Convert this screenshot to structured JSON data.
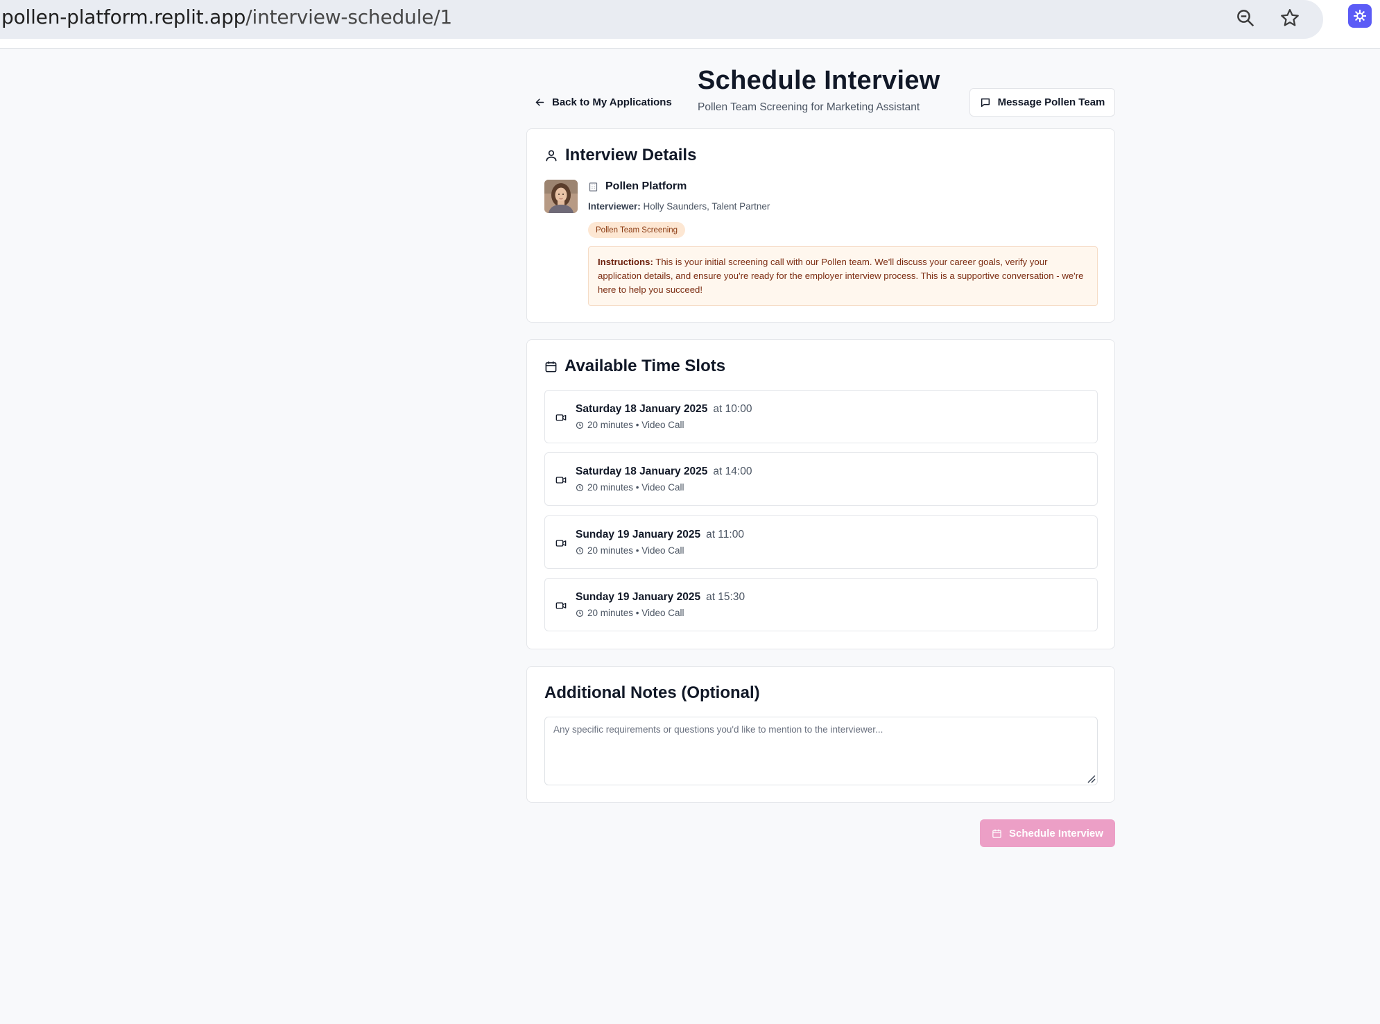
{
  "browser": {
    "url_host": "pollen-platform.replit.app",
    "url_path": "/interview-schedule/1"
  },
  "header": {
    "back_label": "Back to My Applications",
    "title": "Schedule Interview",
    "subtitle": "Pollen Team Screening for Marketing Assistant",
    "message_button": "Message Pollen Team"
  },
  "details": {
    "title": "Interview Details",
    "company": "Pollen Platform",
    "interviewer_label": "Interviewer:",
    "interviewer_value": "Holly Saunders, Talent Partner",
    "badge": "Pollen Team Screening",
    "instructions_label": "Instructions:",
    "instructions_text": "This is your initial screening call with our Pollen team. We'll discuss your career goals, verify your application details, and ensure you're ready for the employer interview process. This is a supportive conversation - we're here to help you succeed!"
  },
  "slots": {
    "title": "Available Time Slots",
    "items": [
      {
        "date": "Saturday 18 January 2025",
        "time": "at 10:00",
        "meta": "20 minutes • Video Call"
      },
      {
        "date": "Saturday 18 January 2025",
        "time": "at 14:00",
        "meta": "20 minutes • Video Call"
      },
      {
        "date": "Sunday 19 January 2025",
        "time": "at 11:00",
        "meta": "20 minutes • Video Call"
      },
      {
        "date": "Sunday 19 January 2025",
        "time": "at 15:30",
        "meta": "20 minutes • Video Call"
      }
    ]
  },
  "notes": {
    "title": "Additional Notes (Optional)",
    "value": "",
    "placeholder": "Any specific requirements or questions you'd like to mention to the interviewer..."
  },
  "submit": {
    "label": "Schedule Interview"
  },
  "colors": {
    "accent_pink_disabled": "#ec9fc6",
    "instructions_bg": "#fff7ee",
    "badge_bg": "#fde7d3",
    "badge_text": "#8a3a12",
    "extension_purple": "#5b5bf6"
  }
}
